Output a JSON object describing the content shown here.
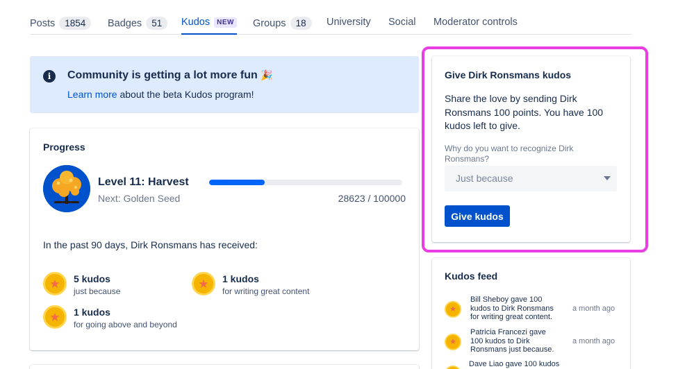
{
  "tabs": [
    {
      "label": "Posts",
      "count": "1854"
    },
    {
      "label": "Badges",
      "count": "51"
    },
    {
      "label": "Kudos",
      "badge": "NEW"
    },
    {
      "label": "Groups",
      "count": "18"
    },
    {
      "label": "University"
    },
    {
      "label": "Social"
    },
    {
      "label": "Moderator controls"
    }
  ],
  "banner": {
    "title": "Community is getting a lot more fun",
    "emoji": "🎉",
    "link_text": "Learn more",
    "rest_text": " about the beta Kudos program!"
  },
  "progress": {
    "heading": "Progress",
    "level_name": "Level 11: Harvest",
    "next_level": "Next: Golden Seed",
    "current": 28623,
    "total": 100000,
    "progress_text": "28623 / 100000",
    "received_text": "In the past 90 days, Dirk Ronsmans has received:",
    "kudos": [
      {
        "title": "5 kudos",
        "reason": "just because"
      },
      {
        "title": "1 kudos",
        "reason": "for writing great content"
      },
      {
        "title": "1 kudos",
        "reason": "for going above and beyond"
      }
    ]
  },
  "give": {
    "heading": "Give Dirk Ronsmans kudos",
    "description": "Share the love by sending Dirk Ronsmans 100 points. You have 100 kudos left to give.",
    "question": "Why do you want to recognize Dirk Ronsmans?",
    "selected_reason": "Just because",
    "button_label": "Give kudos"
  },
  "feed": {
    "heading": "Kudos feed",
    "items": [
      {
        "text": "Bill Sheboy gave 100 kudos to Dirk Ronsmans for writing great content.",
        "time": "a month ago"
      },
      {
        "text": "Patricia Francezi gave 100 kudos to Dirk Ronsmans just because.",
        "time": "a month ago"
      },
      {
        "text": "Dave Liao gave 100 kudos",
        "time": ""
      }
    ]
  },
  "colors": {
    "accent": "#0052cc",
    "highlight": "#e83ee4",
    "banner_bg": "#deebff",
    "coin": "#f5b400"
  }
}
